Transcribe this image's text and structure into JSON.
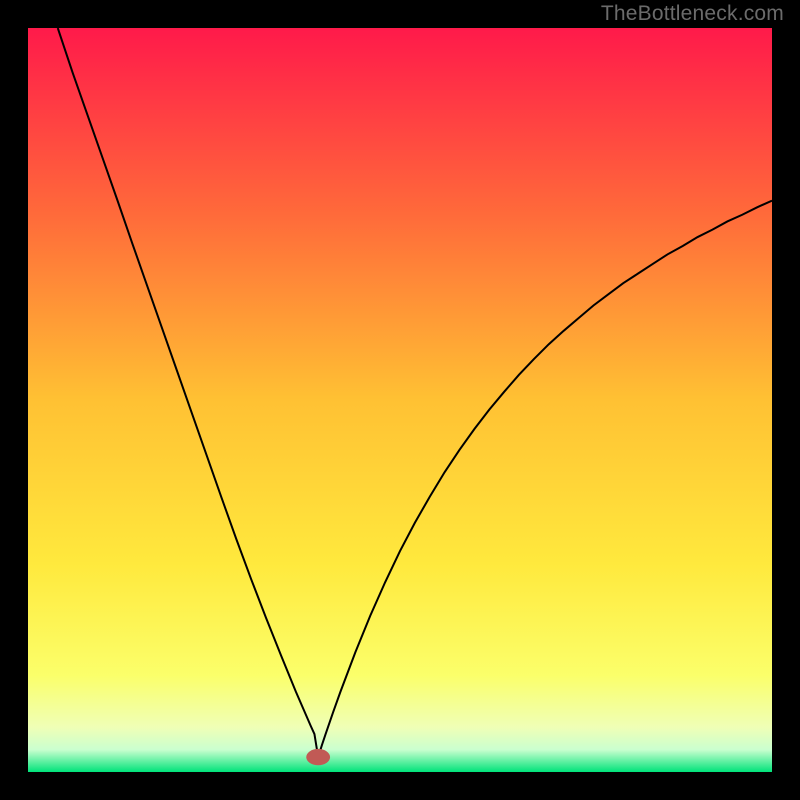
{
  "watermark": "TheBottleneck.com",
  "chart_data": {
    "type": "line",
    "title": "",
    "xlabel": "",
    "ylabel": "",
    "xlim": [
      0,
      100
    ],
    "ylim": [
      0,
      100
    ],
    "grid": false,
    "legend": false,
    "background_gradient_stops": [
      {
        "offset": 0.0,
        "color": "#ff1a4a"
      },
      {
        "offset": 0.25,
        "color": "#ff6a3a"
      },
      {
        "offset": 0.5,
        "color": "#ffc133"
      },
      {
        "offset": 0.72,
        "color": "#ffe93d"
      },
      {
        "offset": 0.87,
        "color": "#fbff6a"
      },
      {
        "offset": 0.94,
        "color": "#efffb6"
      },
      {
        "offset": 0.97,
        "color": "#caffcf"
      },
      {
        "offset": 1.0,
        "color": "#00e37a"
      }
    ],
    "marker": {
      "x": 39,
      "y": 2.0,
      "color": "#c15a55",
      "rx": 1.6,
      "ry": 1.1
    },
    "series": [
      {
        "name": "curve",
        "stroke": "#000000",
        "x": [
          4,
          6,
          8,
          10,
          12,
          14,
          16,
          18,
          20,
          22,
          24,
          26,
          28,
          30,
          32,
          34,
          36,
          37,
          38,
          38.5,
          39,
          39.5,
          40,
          41,
          42,
          44,
          46,
          48,
          50,
          52,
          54,
          56,
          58,
          60,
          62,
          64,
          66,
          68,
          70,
          72,
          74,
          76,
          78,
          80,
          82,
          84,
          86,
          88,
          90,
          92,
          94,
          96,
          98,
          100
        ],
        "y": [
          100,
          94,
          88.3,
          82.6,
          76.9,
          71.1,
          65.4,
          59.7,
          54,
          48.3,
          42.6,
          36.9,
          31.3,
          25.9,
          20.7,
          15.7,
          10.8,
          8.5,
          6.2,
          5.1,
          2.0,
          3.6,
          5.1,
          8.0,
          10.8,
          16.1,
          21.0,
          25.5,
          29.7,
          33.5,
          37.0,
          40.3,
          43.3,
          46.1,
          48.7,
          51.1,
          53.4,
          55.5,
          57.5,
          59.3,
          61.0,
          62.7,
          64.2,
          65.7,
          67.0,
          68.3,
          69.6,
          70.7,
          71.9,
          72.9,
          74.0,
          74.9,
          75.9,
          76.8
        ]
      }
    ]
  }
}
